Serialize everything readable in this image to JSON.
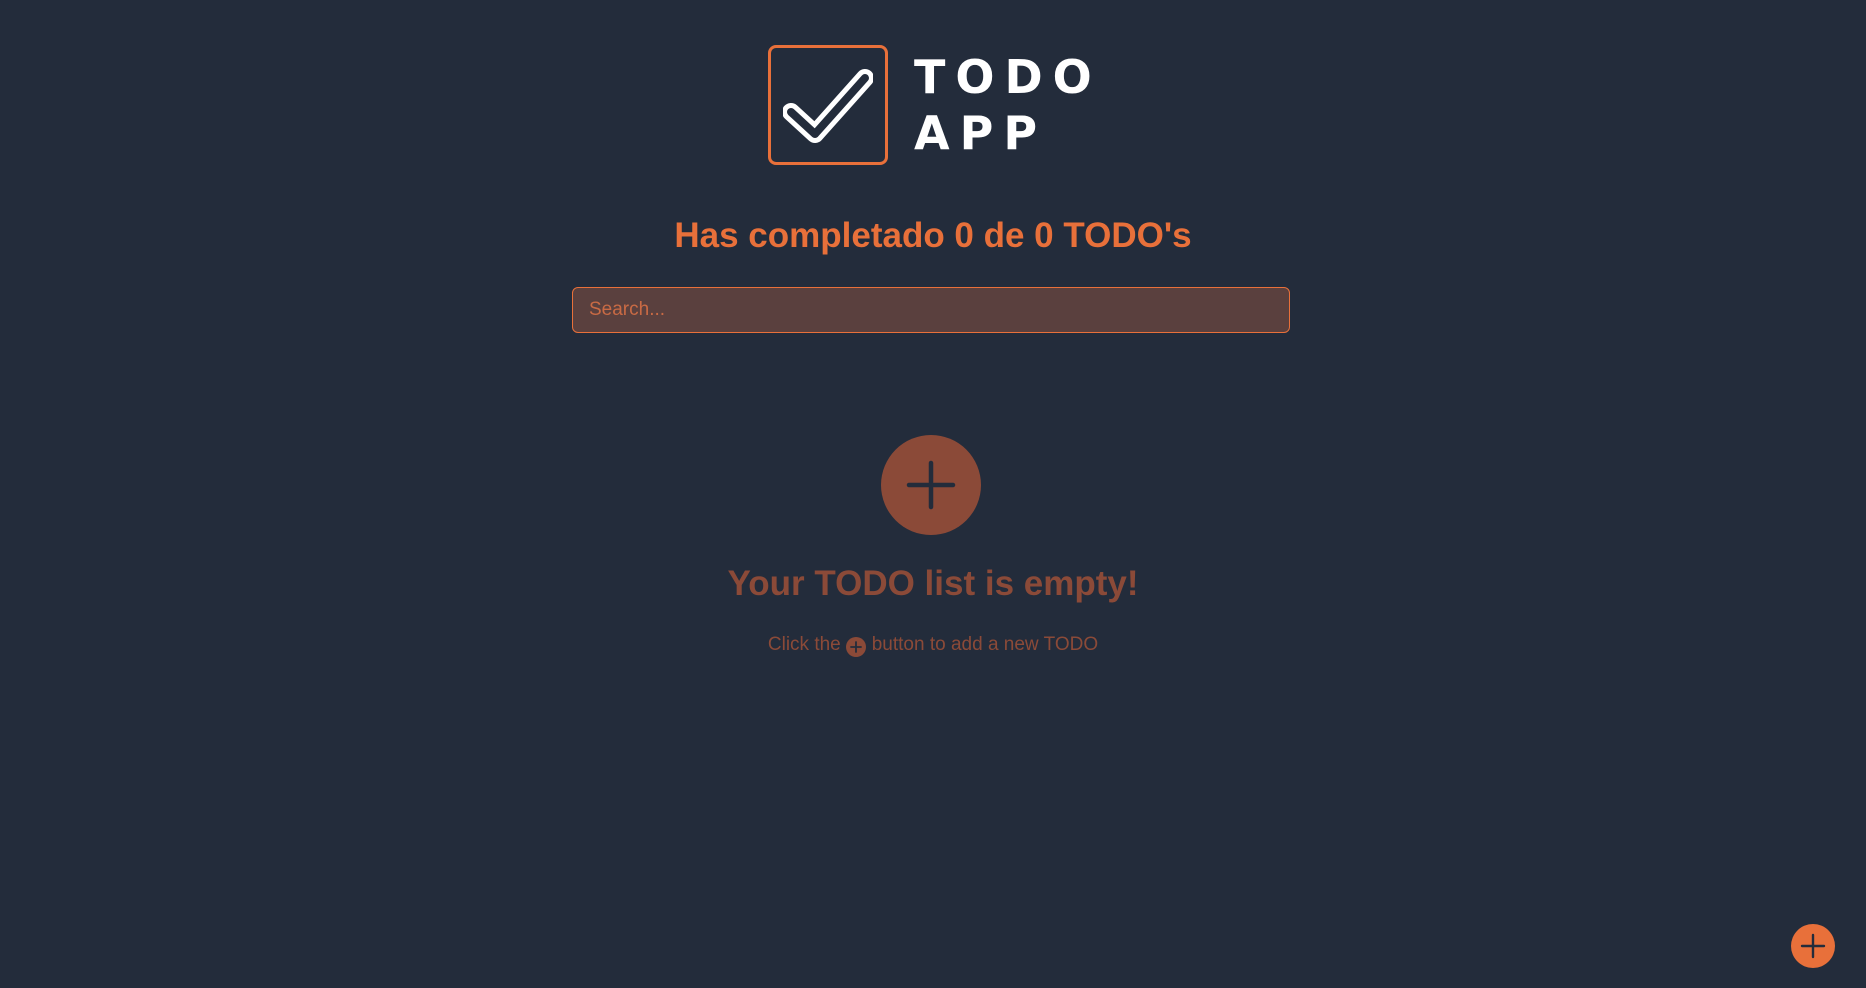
{
  "app": {
    "logo": {
      "line1": "TODO",
      "line2": "APP",
      "icon": "check-icon"
    },
    "colors": {
      "background": "#232c3b",
      "accent": "#e8703a",
      "muted_accent": "#8b4a38",
      "search_background": "#5a403e"
    }
  },
  "counter": {
    "text": "Has completado 0 de 0 TODO's",
    "completed": 0,
    "total": 0
  },
  "search": {
    "placeholder": "Search...",
    "value": ""
  },
  "empty_state": {
    "icon": "plus-icon",
    "title": "Your TODO list is empty!",
    "hint_before": "Click the",
    "hint_after": "button to add a new TODO"
  },
  "fab": {
    "icon": "plus-icon"
  }
}
